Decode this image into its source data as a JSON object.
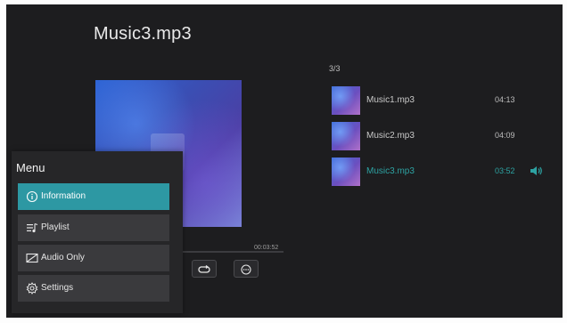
{
  "now_playing": {
    "title": "Music3.mp3",
    "total_time": "00:03:52"
  },
  "playlist": {
    "counter": "3/3",
    "tracks": [
      {
        "name": "Music1.mp3",
        "duration": "04:13"
      },
      {
        "name": "Music2.mp3",
        "duration": "04:09"
      },
      {
        "name": "Music3.mp3",
        "duration": "03:52",
        "playing": true
      }
    ]
  },
  "menu": {
    "title": "Menu",
    "items": [
      {
        "label": "Information",
        "icon": "info-icon",
        "selected": true
      },
      {
        "label": "Playlist",
        "icon": "playlist-icon"
      },
      {
        "label": "Audio Only",
        "icon": "audio-only-icon"
      },
      {
        "label": "Settings",
        "icon": "gear-icon"
      }
    ]
  },
  "controls": {
    "icons": [
      "repeat-icon",
      "more-icon"
    ]
  },
  "colors": {
    "background": "#1d1d1f",
    "accent": "#2d98a3",
    "active_text": "#2da2a2"
  }
}
